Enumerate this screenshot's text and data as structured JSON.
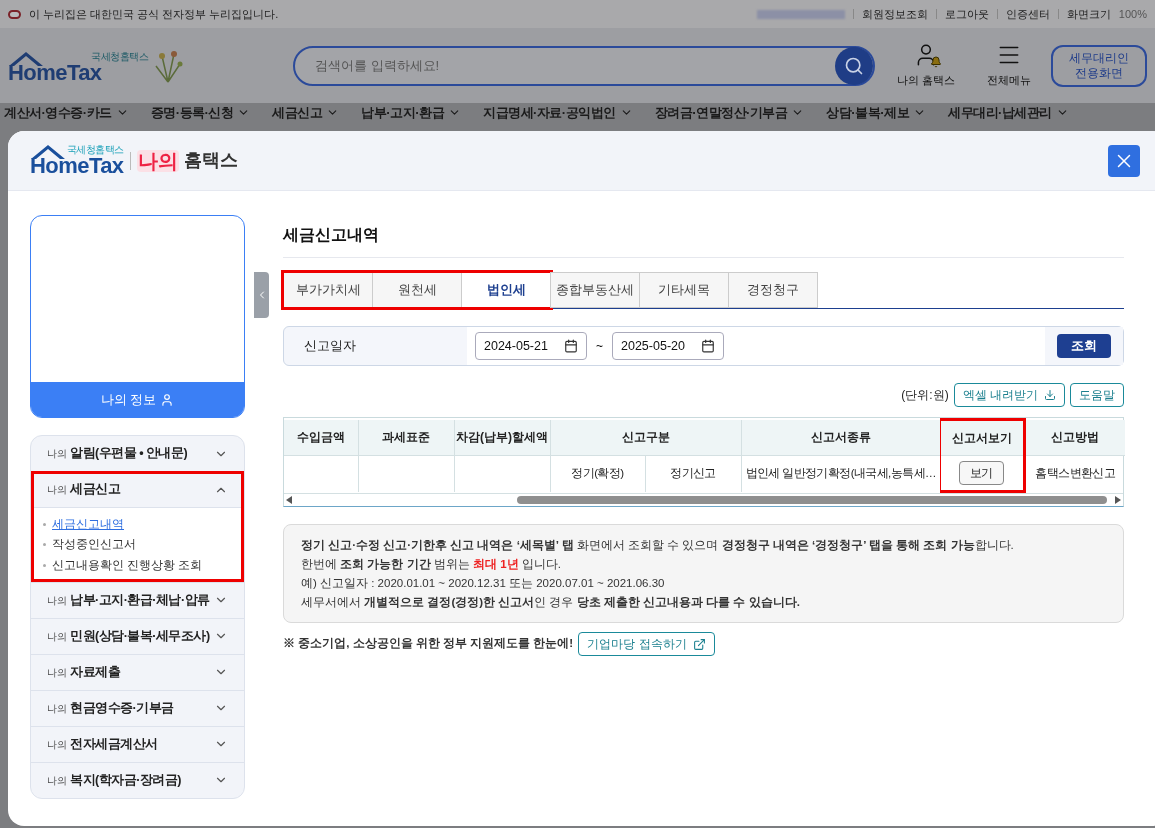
{
  "gov_banner": {
    "text": "이 누리집은 대한민국 공식 전자정부 누리집입니다.",
    "links": [
      "회원정보조회",
      "로그아웃",
      "인증센터"
    ],
    "zoom": {
      "label": "화면크기",
      "value": "100%"
    }
  },
  "site_header": {
    "logo": {
      "subtitle": "국세청홈택스",
      "title": "HomeTax"
    },
    "search": {
      "placeholder": "검색어를 입력하세요!"
    },
    "actions": [
      {
        "kind": "my",
        "lines": [
          "나의 홈택스"
        ]
      },
      {
        "kind": "menu",
        "lines": [
          "전체메뉴"
        ]
      },
      {
        "kind": "agent",
        "lines": [
          "세무대리인",
          "전용화면"
        ]
      }
    ]
  },
  "nav": [
    "계산서·영수증·카드",
    "증명·등록·신청",
    "세금신고",
    "납부·고지·환급",
    "지급명세·자료·공익법인",
    "장려금·연말정산·기부금",
    "상담·불복·제보",
    "세무대리·납세관리"
  ],
  "modal": {
    "logo": {
      "subtitle": "국세청홈택스",
      "title": "HomeTax"
    },
    "heading_accent": "나의",
    "heading": "홈택스",
    "sidebar": {
      "profile_button": "나의 정보",
      "menu": [
        {
          "prefix": "나의",
          "label": "알림(우편물 • 안내문)",
          "expanded": false,
          "highlighted": false
        },
        {
          "prefix": "나의",
          "label": "세금신고",
          "expanded": true,
          "highlighted": true,
          "children": [
            {
              "label": "세금신고내역",
              "selected": true
            },
            {
              "label": "작성중인신고서",
              "selected": false
            },
            {
              "label": "신고내용확인 진행상황 조회",
              "selected": false
            }
          ]
        },
        {
          "prefix": "나의",
          "label": "납부·고지·환급·체납·압류",
          "expanded": false,
          "highlighted": false
        },
        {
          "prefix": "나의",
          "label": "민원(상담·불복·세무조사)",
          "expanded": false,
          "highlighted": false
        },
        {
          "prefix": "나의",
          "label": "자료제출",
          "expanded": false,
          "highlighted": false
        },
        {
          "prefix": "나의",
          "label": "현금영수증·기부금",
          "expanded": false,
          "highlighted": false
        },
        {
          "prefix": "나의",
          "label": "전자세금계산서",
          "expanded": false,
          "highlighted": false
        },
        {
          "prefix": "나의",
          "label": "복지(학자금·장려금)",
          "expanded": false,
          "highlighted": false
        }
      ]
    },
    "main": {
      "title": "세금신고내역",
      "tabs": [
        {
          "label": "부가가치세",
          "selected": false,
          "highlighted": true
        },
        {
          "label": "원천세",
          "selected": false,
          "highlighted": true
        },
        {
          "label": "법인세",
          "selected": true,
          "highlighted": true
        },
        {
          "label": "종합부동산세",
          "selected": false,
          "highlighted": false
        },
        {
          "label": "기타세목",
          "selected": false,
          "highlighted": false
        },
        {
          "label": "경정청구",
          "selected": false,
          "highlighted": false
        }
      ],
      "filter": {
        "label": "신고일자",
        "from": "2024-05-21",
        "separator": "~",
        "to": "2025-05-20",
        "button": "조회"
      },
      "toolbar": {
        "unit": "(단위:원)",
        "excel_button": "엑셀 내려받기",
        "help_button": "도움말"
      },
      "table": {
        "columns": [
          {
            "label": "수입금액",
            "kind": "single",
            "highlighted": false
          },
          {
            "label": "과세표준",
            "kind": "single",
            "highlighted": false
          },
          {
            "label": "차감(납부)할세액",
            "kind": "single",
            "highlighted": false
          },
          {
            "label": "신고구분",
            "kind": "split",
            "colspan": 2,
            "highlighted": false
          },
          {
            "label": "신고서종류",
            "kind": "single",
            "highlighted": false
          },
          {
            "label": "신고서보기",
            "kind": "single",
            "highlighted": true
          },
          {
            "label": "신고방법",
            "kind": "single",
            "highlighted": false
          }
        ],
        "rows": [
          {
            "cells": [
              null,
              null,
              null,
              "정기(확정)",
              "정기신고",
              "법인세 일반정기확정(내국세,농특세…",
              {
                "button": "보기"
              },
              "홈택스변환신고"
            ]
          }
        ]
      },
      "notice": [
        [
          {
            "text": "정기 신고·수정 신고·기한후 신고 내역은 ‘세목별’ 탭",
            "kind": "bold"
          },
          {
            "text": " 화면에서 조회할 수 있으며 ",
            "kind": "plain"
          },
          {
            "text": "경정청구 내역은 ‘경정청구’ 탭을 통해 조회 가능",
            "kind": "bold"
          },
          {
            "text": "합니다.",
            "kind": "plain"
          }
        ],
        [
          {
            "text": "한번에 ",
            "kind": "plain"
          },
          {
            "text": "조회 가능한 기간",
            "kind": "bold"
          },
          {
            "text": " 범위는 ",
            "kind": "plain"
          },
          {
            "text": "최대 1년",
            "kind": "alert"
          },
          {
            "text": " 입니다.",
            "kind": "plain"
          }
        ],
        [
          {
            "text": "예) 신고일자 : 2020.01.01 ~ 2020.12.31 또는 2020.07.01 ~ 2021.06.30",
            "kind": "plain"
          }
        ],
        [
          {
            "text": "세무서에서 ",
            "kind": "plain"
          },
          {
            "text": "개별적으로 결정(경정)한 신고서",
            "kind": "bold"
          },
          {
            "text": "인 경우 ",
            "kind": "plain"
          },
          {
            "text": "당초 제출한 신고내용과 다를 수 있습니다.",
            "kind": "bold"
          }
        ]
      ],
      "footer": {
        "text": "※ 중소기업, 소상공인을 위한 정부 지원제도를 한눈에!",
        "link": "기업마당 접속하기"
      }
    }
  }
}
